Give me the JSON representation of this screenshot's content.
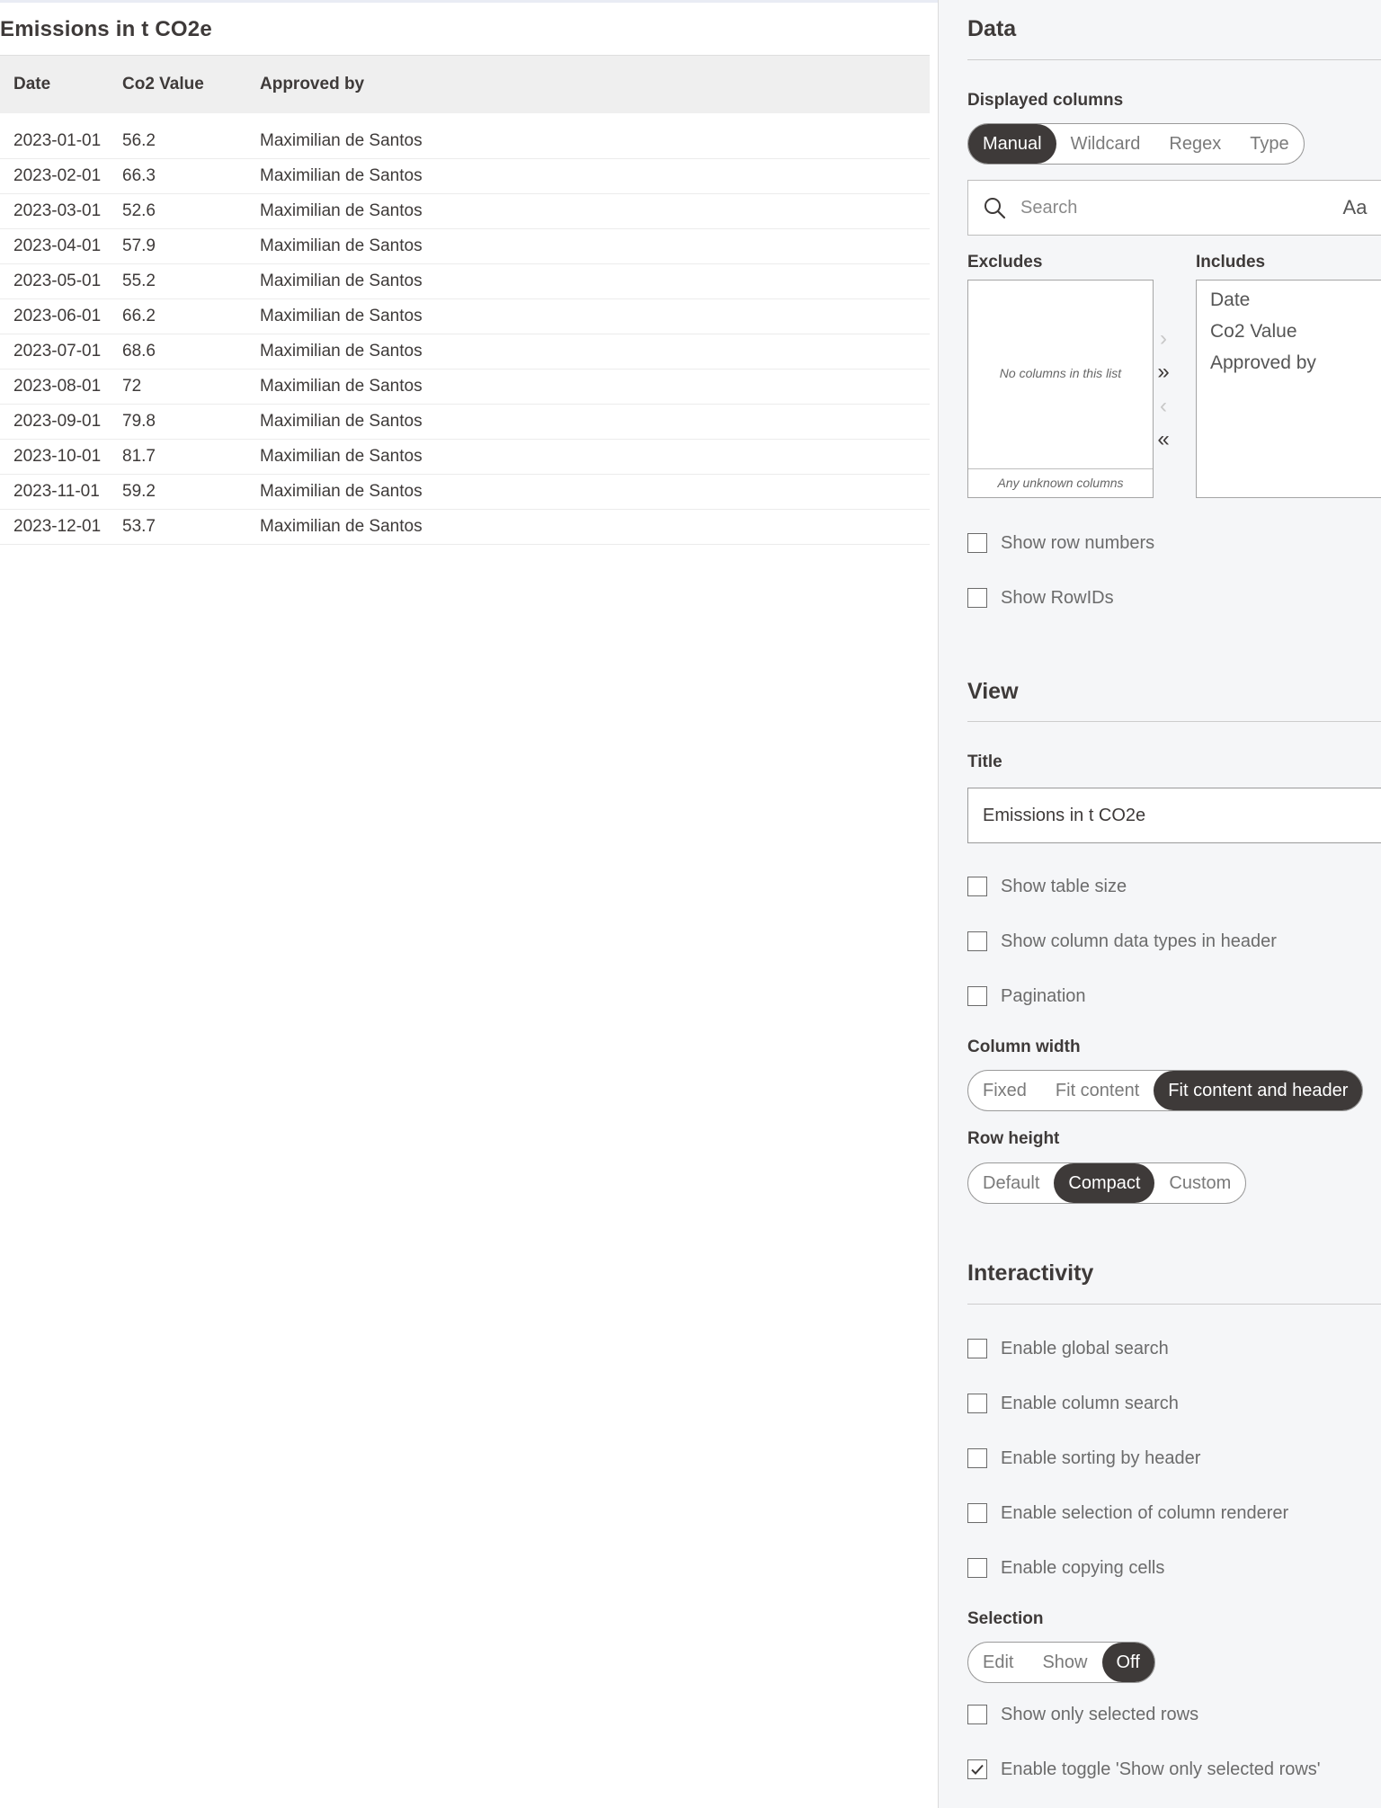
{
  "table": {
    "title": "Emissions in t CO2e",
    "columns": [
      "Date",
      "Co2 Value",
      "Approved by"
    ],
    "rows": [
      [
        "2023-01-01",
        "56.2",
        "Maximilian de Santos"
      ],
      [
        "2023-02-01",
        "66.3",
        "Maximilian de Santos"
      ],
      [
        "2023-03-01",
        "52.6",
        "Maximilian de Santos"
      ],
      [
        "2023-04-01",
        "57.9",
        "Maximilian de Santos"
      ],
      [
        "2023-05-01",
        "55.2",
        "Maximilian de Santos"
      ],
      [
        "2023-06-01",
        "66.2",
        "Maximilian de Santos"
      ],
      [
        "2023-07-01",
        "68.6",
        "Maximilian de Santos"
      ],
      [
        "2023-08-01",
        "72",
        "Maximilian de Santos"
      ],
      [
        "2023-09-01",
        "79.8",
        "Maximilian de Santos"
      ],
      [
        "2023-10-01",
        "81.7",
        "Maximilian de Santos"
      ],
      [
        "2023-11-01",
        "59.2",
        "Maximilian de Santos"
      ],
      [
        "2023-12-01",
        "53.7",
        "Maximilian de Santos"
      ]
    ]
  },
  "panel": {
    "data": {
      "heading": "Data",
      "displayed_columns_label": "Displayed columns",
      "mode_options": [
        "Manual",
        "Wildcard",
        "Regex",
        "Type"
      ],
      "mode_selected": "Manual",
      "search_placeholder": "Search",
      "case_toggle": "Aa",
      "excludes_label": "Excludes",
      "includes_label": "Includes",
      "excludes_empty": "No columns in this list",
      "excludes_footer": "Any unknown columns",
      "includes_items": [
        "Date",
        "Co2 Value",
        "Approved by"
      ],
      "arrows": {
        "move_right": "›",
        "move_all_right": "»",
        "move_left": "‹",
        "move_all_left": "«"
      },
      "show_row_numbers": {
        "label": "Show row numbers",
        "checked": false
      },
      "show_rowids": {
        "label": "Show RowIDs",
        "checked": false
      }
    },
    "view": {
      "heading": "View",
      "title_label": "Title",
      "title_value": "Emissions in t CO2e",
      "show_table_size": {
        "label": "Show table size",
        "checked": false
      },
      "show_column_types": {
        "label": "Show column data types in header",
        "checked": false
      },
      "pagination": {
        "label": "Pagination",
        "checked": false
      },
      "column_width_label": "Column width",
      "column_width_options": [
        "Fixed",
        "Fit content",
        "Fit content and header"
      ],
      "column_width_selected": "Fit content and header",
      "row_height_label": "Row height",
      "row_height_options": [
        "Default",
        "Compact",
        "Custom"
      ],
      "row_height_selected": "Compact"
    },
    "interactivity": {
      "heading": "Interactivity",
      "global_search": {
        "label": "Enable global search",
        "checked": false
      },
      "column_search": {
        "label": "Enable column search",
        "checked": false
      },
      "sorting": {
        "label": "Enable sorting by header",
        "checked": false
      },
      "renderer_selection": {
        "label": "Enable selection of column renderer",
        "checked": false
      },
      "copying": {
        "label": "Enable copying cells",
        "checked": false
      },
      "selection_label": "Selection",
      "selection_options": [
        "Edit",
        "Show",
        "Off"
      ],
      "selection_selected": "Off",
      "show_only_selected": {
        "label": "Show only selected rows",
        "checked": false
      },
      "toggle_show_only_selected": {
        "label": "Enable toggle 'Show only selected rows'",
        "checked": true
      }
    }
  }
}
